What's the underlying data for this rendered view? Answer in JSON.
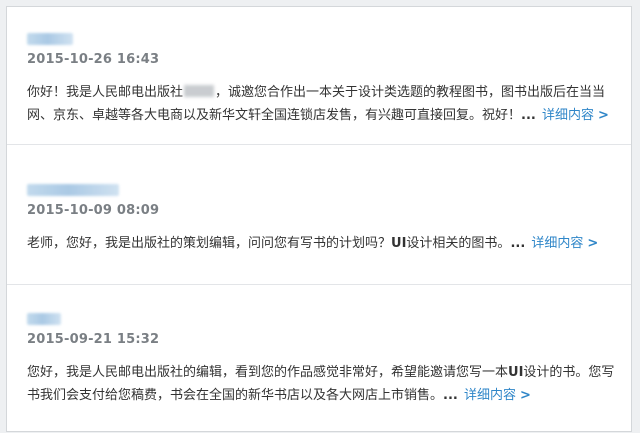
{
  "messages": [
    {
      "sender": "一蓝莓",
      "timestamp": "2015-10-26 16:43",
      "body_pre": "你好！我是人民邮电出版社",
      "body_post": "，诚邀您合作出一本关于设计类选题的教程图书，图书出版后在当当网、京东、卓越等各大电商以及新华文轩全国连锁店发售，有兴趣可直接回复。祝好！",
      "ellipsis": "...",
      "more_label": "详细内容",
      "more_icon": "chevron-right-icon"
    },
    {
      "sender": "kyhope2012",
      "timestamp": "2015-10-09 08:09",
      "body_pre": "老师，您好，我是出版社的策划编辑，问问您有写书的计划吗？",
      "body_bold": "UI",
      "body_post": "设计相关的图书。",
      "ellipsis": "...",
      "more_label": "详细内容",
      "more_icon": "chevron-right-icon"
    },
    {
      "sender": "徐潇",
      "timestamp": "2015-09-21 15:32",
      "body_pre": "您好，我是人民邮电出版社的编辑，看到您的作品感觉非常好，希望能邀请您写一本",
      "body_bold": "UI",
      "body_post": "设计的书。您写书我们会支付给您稿费，书会在全国的新华书店以及各大网店上市销售。",
      "ellipsis": "...",
      "more_label": "详细内容",
      "more_icon": "chevron-right-icon"
    }
  ],
  "colors": {
    "link": "#2f86c8",
    "timestamp": "#7a7f84",
    "text": "#333333"
  }
}
